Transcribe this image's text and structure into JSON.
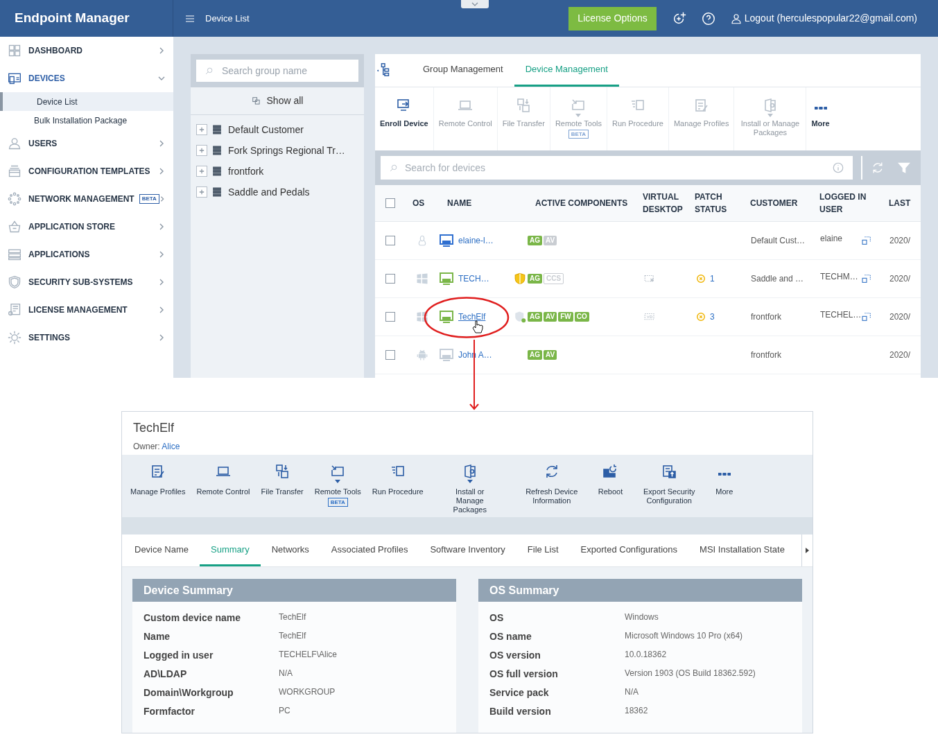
{
  "app_title": "Endpoint Manager",
  "header": {
    "page_title": "Device List",
    "license_button": "License Options",
    "account": "Logout (herculespopular22@gmail.com)"
  },
  "sidebar": {
    "items": [
      {
        "kind": "dashboard",
        "label": "DASHBOARD",
        "selected": false,
        "expanded": false
      },
      {
        "kind": "devices",
        "label": "DEVICES",
        "selected": true,
        "expanded": true,
        "children": [
          {
            "label": "Device List",
            "selected": true
          },
          {
            "label": "Bulk Installation Package",
            "selected": false
          }
        ]
      },
      {
        "kind": "users",
        "label": "USERS",
        "selected": false,
        "expanded": false
      },
      {
        "kind": "templates",
        "label": "CONFIGURATION TEMPLATES",
        "selected": false,
        "expanded": false
      },
      {
        "kind": "network",
        "label": "NETWORK MANAGEMENT",
        "badge": "BETA",
        "selected": false,
        "expanded": false
      },
      {
        "kind": "store",
        "label": "APPLICATION STORE",
        "selected": false,
        "expanded": false
      },
      {
        "kind": "apps",
        "label": "APPLICATIONS",
        "selected": false,
        "expanded": false
      },
      {
        "kind": "security",
        "label": "SECURITY SUB-SYSTEMS",
        "selected": false,
        "expanded": false
      },
      {
        "kind": "license",
        "label": "LICENSE MANAGEMENT",
        "selected": false,
        "expanded": false
      },
      {
        "kind": "settings",
        "label": "SETTINGS",
        "selected": false,
        "expanded": false
      }
    ]
  },
  "group_panel": {
    "placeholder": "Search group name",
    "show_all": "Show all",
    "groups": [
      "Default Customer",
      "Fork Springs Regional Tr…",
      "frontfork",
      "Saddle and Pedals"
    ]
  },
  "tabs": [
    {
      "label": "Group Management",
      "selected": false
    },
    {
      "label": "Device Management",
      "selected": true
    }
  ],
  "toolbar": [
    {
      "kind": "enroll",
      "label": "Enroll Device",
      "disabled": false,
      "dropdown": false
    },
    {
      "kind": "remote-control",
      "label": "Remote Control",
      "disabled": true,
      "dropdown": false
    },
    {
      "kind": "file-transfer",
      "label": "File Transfer",
      "disabled": true,
      "dropdown": false
    },
    {
      "kind": "remote-tools",
      "label": "Remote Tools",
      "disabled": true,
      "dropdown": true,
      "badge": "BETA"
    },
    {
      "kind": "run-procedure",
      "label": "Run Procedure",
      "disabled": true,
      "dropdown": false
    },
    {
      "kind": "profiles",
      "label": "Manage Profiles",
      "disabled": true,
      "dropdown": false
    },
    {
      "kind": "packages",
      "label": "Install or Manage Packages",
      "disabled": true,
      "dropdown": true
    },
    {
      "kind": "more",
      "label": "More",
      "disabled": false,
      "dropdown": false
    }
  ],
  "device_search": {
    "placeholder": "Search for devices"
  },
  "table": {
    "select_all": {
      "checked": false
    },
    "columns": [
      "OS",
      "NAME",
      "ACTIVE COMPONENTS",
      "VIRTUAL DESKTOP",
      "PATCH STATUS",
      "CUSTOMER",
      "LOGGED IN USER",
      "LAST"
    ],
    "rows": [
      {
        "checked": false,
        "os_icon": {
          "kind": "linux"
        },
        "color": "#2f6fd0",
        "name": "elaine-l…",
        "highlighted": false,
        "components": [
          {
            "label": "AG",
            "kind": "on"
          },
          {
            "label": "AV",
            "kind": "off"
          }
        ],
        "customer": "Default Cust…",
        "user": "elaine",
        "remote_access": true,
        "last": "2020/"
      },
      {
        "checked": false,
        "os_icon": {
          "kind": "windows"
        },
        "color": "#7ab648",
        "name": "TECH…",
        "highlighted": false,
        "shield": {
          "kind": "warning"
        },
        "components": [
          {
            "label": "AG",
            "kind": "on"
          },
          {
            "label": "CCS",
            "kind": "outline"
          }
        ],
        "virtual_desktop": {
          "kind": "unavailable"
        },
        "patch": "1",
        "customer": "Saddle and …",
        "user": "TECHM…",
        "remote_access": true,
        "last": "2020/"
      },
      {
        "checked": false,
        "os_icon": {
          "kind": "windows"
        },
        "color": "#7ab648",
        "name": "TechElf",
        "highlighted": true,
        "shield": {
          "kind": "protected"
        },
        "components": [
          {
            "label": "AG",
            "kind": "on"
          },
          {
            "label": "AV",
            "kind": "on"
          },
          {
            "label": "FW",
            "kind": "on"
          },
          {
            "label": "CO",
            "kind": "on"
          }
        ],
        "virtual_desktop": {
          "kind": "available"
        },
        "patch": "3",
        "customer": "frontfork",
        "user": "TECHEL…",
        "remote_access": true,
        "last": "2020/"
      },
      {
        "checked": false,
        "os_icon": {
          "kind": "android"
        },
        "color": "#c5ced8",
        "name": "John A…",
        "highlighted": false,
        "components": [
          {
            "label": "AG",
            "kind": "on"
          },
          {
            "label": "AV",
            "kind": "on"
          }
        ],
        "customer": "frontfork",
        "remote_access": false,
        "last": "2020/"
      }
    ]
  },
  "detail": {
    "title": "TechElf",
    "owner_label": "Owner:",
    "owner": "Alice",
    "toolbar": [
      {
        "kind": "profiles",
        "label": "Manage Profiles",
        "dropdown": false
      },
      {
        "kind": "remote-control",
        "label": "Remote Control",
        "dropdown": false
      },
      {
        "kind": "file-transfer",
        "label": "File Transfer",
        "dropdown": false
      },
      {
        "kind": "remote-tools",
        "label": "Remote Tools",
        "dropdown": true,
        "badge": "BETA"
      },
      {
        "kind": "run-procedure",
        "label": "Run Procedure",
        "dropdown": false
      },
      {
        "kind": "packages",
        "label": "Install or Manage Packages",
        "dropdown": true
      },
      {
        "kind": "refresh",
        "label": "Refresh Device Information",
        "dropdown": false
      },
      {
        "kind": "reboot",
        "label": "Reboot",
        "dropdown": false
      },
      {
        "kind": "export",
        "label": "Export Security Configuration",
        "dropdown": false
      },
      {
        "kind": "more",
        "label": "More",
        "dropdown": false
      }
    ],
    "tabs": [
      {
        "label": "Device Name",
        "selected": false
      },
      {
        "label": "Summary",
        "selected": true
      },
      {
        "label": "Networks",
        "selected": false
      },
      {
        "label": "Associated Profiles",
        "selected": false
      },
      {
        "label": "Software Inventory",
        "selected": false
      },
      {
        "label": "File List",
        "selected": false
      },
      {
        "label": "Exported Configurations",
        "selected": false
      },
      {
        "label": "MSI Installation State",
        "selected": false
      }
    ],
    "sections": [
      {
        "title": "Device Summary",
        "fields": [
          {
            "label": "Custom device name",
            "value": "TechElf"
          },
          {
            "label": "Name",
            "value": "TechElf"
          },
          {
            "label": "Logged in user",
            "value": "TECHELF\\Alice"
          },
          {
            "label": "AD\\LDAP",
            "value": "N/A"
          },
          {
            "label": "Domain\\Workgroup",
            "value": "WORKGROUP"
          },
          {
            "label": "Formfactor",
            "value": "PC"
          }
        ]
      },
      {
        "title": "OS Summary",
        "fields": [
          {
            "label": "OS",
            "value": "Windows"
          },
          {
            "label": "OS name",
            "value": "Microsoft Windows 10 Pro (x64)"
          },
          {
            "label": "OS version",
            "value": "10.0.18362"
          },
          {
            "label": "OS full version",
            "value": "Version 1903 (OS Build 18362.592)"
          },
          {
            "label": "Service pack",
            "value": "N/A"
          },
          {
            "label": "Build version",
            "value": "18362"
          }
        ]
      }
    ]
  }
}
